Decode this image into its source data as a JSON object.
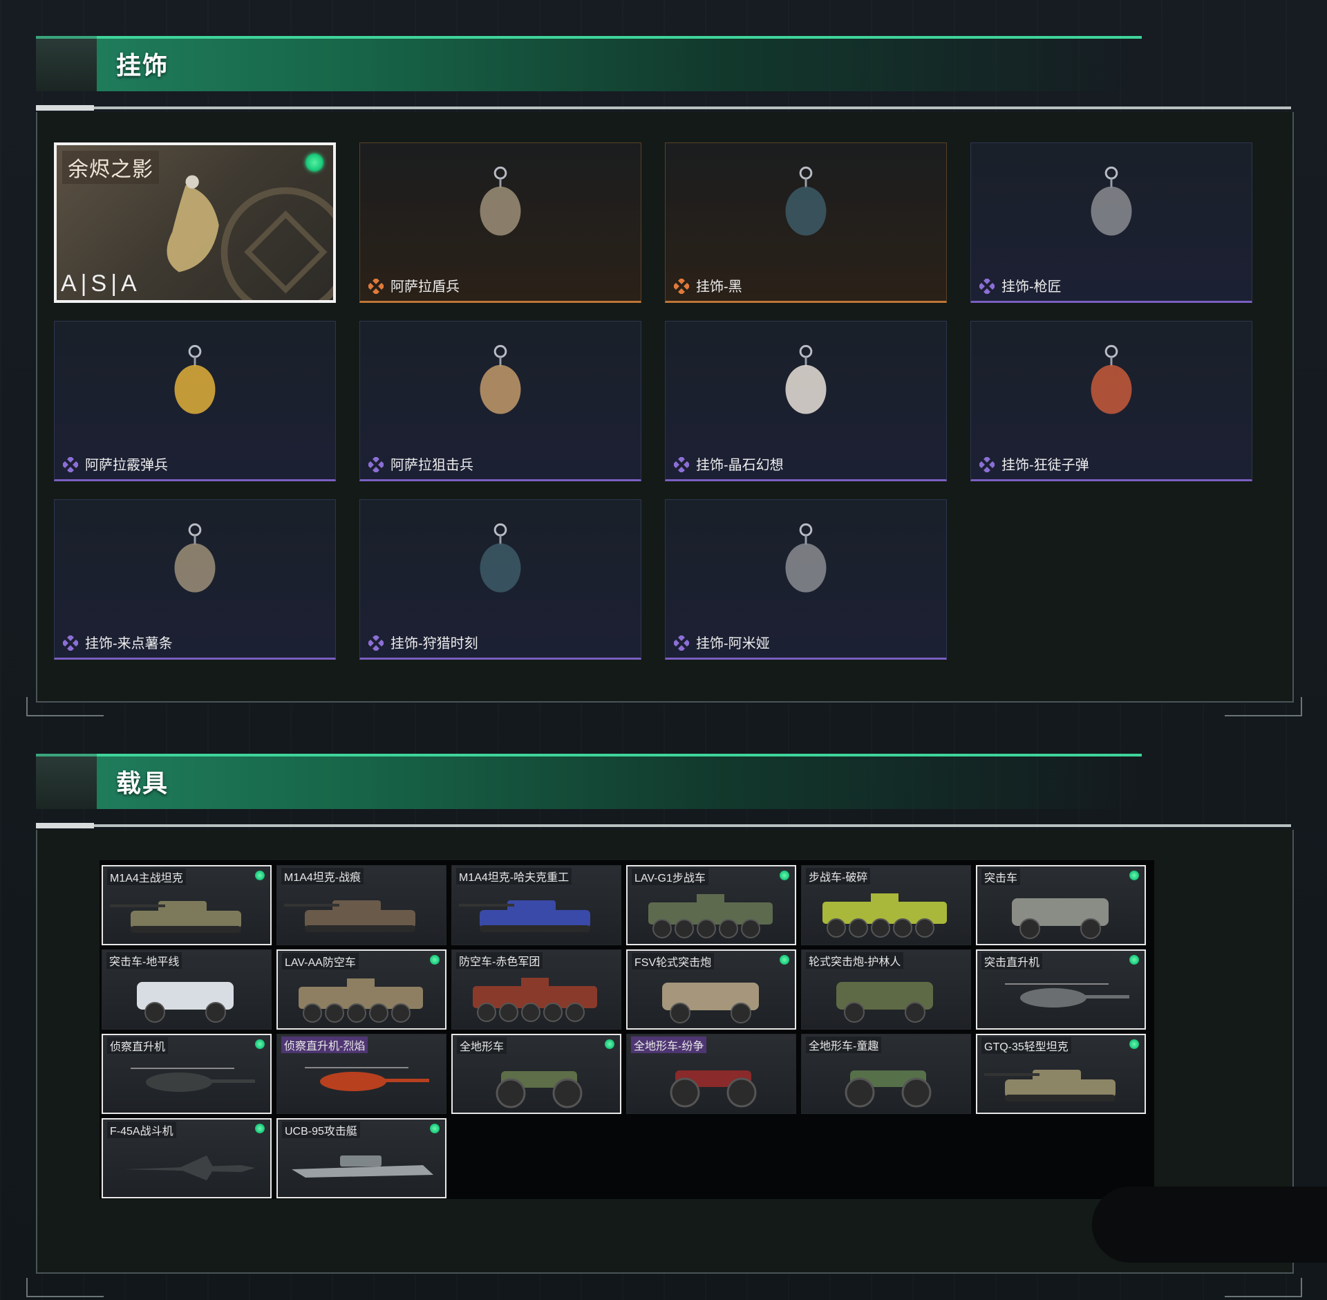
{
  "sections": {
    "pendants": {
      "title": "挂饰"
    },
    "vehicles": {
      "title": "载具"
    }
  },
  "pendants": [
    {
      "name": "余烬之影",
      "brand": "A|S|A",
      "rarity": "special",
      "equipped": true
    },
    {
      "name": "阿萨拉盾兵",
      "rarity": "orange"
    },
    {
      "name": "挂饰-黑",
      "rarity": "orange"
    },
    {
      "name": "挂饰-枪匠",
      "rarity": "purple"
    },
    {
      "name": "阿萨拉霰弹兵",
      "rarity": "purple"
    },
    {
      "name": "阿萨拉狙击兵",
      "rarity": "purple"
    },
    {
      "name": "挂饰-晶石幻想",
      "rarity": "purple"
    },
    {
      "name": "挂饰-狂徒子弹",
      "rarity": "purple"
    },
    {
      "name": "挂饰-来点薯条",
      "rarity": "purple"
    },
    {
      "name": "挂饰-狩猎时刻",
      "rarity": "purple"
    },
    {
      "name": "挂饰-阿米娅",
      "rarity": "purple"
    }
  ],
  "vehicles": [
    {
      "name": "M1A4主战坦克",
      "owned": true,
      "kind": "tank",
      "color": "#7d7a5c"
    },
    {
      "name": "M1A4坦克-战痕",
      "owned": false,
      "kind": "tank",
      "color": "#6a5a4a"
    },
    {
      "name": "M1A4坦克-哈夫克重工",
      "owned": false,
      "kind": "tank",
      "color": "#3a4aa8"
    },
    {
      "name": "LAV-G1步战车",
      "owned": true,
      "kind": "apc",
      "color": "#5d6a4e"
    },
    {
      "name": "步战车-破碎",
      "owned": false,
      "kind": "apc",
      "color": "#a9b83a"
    },
    {
      "name": "突击车",
      "owned": true,
      "kind": "truck",
      "color": "#8a8c86"
    },
    {
      "name": "突击车-地平线",
      "owned": false,
      "kind": "truck",
      "color": "#d8dde4"
    },
    {
      "name": "LAV-AA防空车",
      "owned": true,
      "kind": "apc",
      "color": "#8e7f62"
    },
    {
      "name": "防空车-赤色军团",
      "owned": false,
      "kind": "apc",
      "color": "#8a3a2a"
    },
    {
      "name": "FSV轮式突击炮",
      "owned": true,
      "kind": "truck",
      "color": "#a5967c"
    },
    {
      "name": "轮式突击炮-护林人",
      "owned": false,
      "kind": "truck",
      "color": "#5e6a45"
    },
    {
      "name": "突击直升机",
      "owned": true,
      "kind": "heli",
      "color": "#6a6e70"
    },
    {
      "name": "侦察直升机",
      "owned": true,
      "kind": "heli",
      "color": "#3c3f40"
    },
    {
      "name": "侦察直升机-烈焰",
      "owned": false,
      "kind": "heli",
      "color": "#b8401e",
      "purple_label": true
    },
    {
      "name": "全地形车",
      "owned": true,
      "kind": "atv",
      "color": "#5d6e48"
    },
    {
      "name": "全地形车-纷争",
      "owned": false,
      "kind": "atv",
      "color": "#8a2a2a",
      "purple_label": true
    },
    {
      "name": "全地形车-童趣",
      "owned": false,
      "kind": "atv",
      "color": "#56704a"
    },
    {
      "name": "GTQ-35轻型坦克",
      "owned": true,
      "kind": "tank",
      "color": "#8c8566"
    },
    {
      "name": "F-45A战斗机",
      "owned": true,
      "kind": "jet",
      "color": "#3e4144"
    },
    {
      "name": "UCB-95攻击艇",
      "owned": true,
      "kind": "boat",
      "color": "#9aa0a4"
    }
  ],
  "colors": {
    "accent_green": "#3fd49a",
    "rarity_purple": "#8b6fd6",
    "rarity_orange": "#e07a3a",
    "equipped_dot": "#1ecf7f"
  }
}
